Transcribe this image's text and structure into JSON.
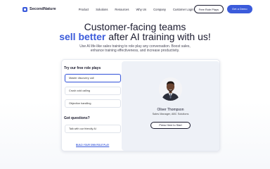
{
  "brand": {
    "name": "SecondNature",
    "accent": "#3b5bdb"
  },
  "nav": {
    "links": [
      "Product",
      "Solutions",
      "Resources",
      "Why Us",
      "Company",
      "Customer Login"
    ],
    "free_plays": "Free Role Plays",
    "demo": "Get a Demo"
  },
  "hero": {
    "line1": "Customer-facing teams",
    "accent": "sell better",
    "line2_rest": " after AI training with us!",
    "subtitle_1": "Use AI life-like sales training to role play any conversation. Boost sales,",
    "subtitle_2": "enhance training effectiveness, and increase productivity."
  },
  "panel": {
    "free_title": "Try our free role plays",
    "options": [
      "Master discovery call",
      "Crush cold calling",
      "Objection handling"
    ],
    "questions_title": "Got questions?",
    "friendly_ai": "Talk with our friendly AI",
    "build_link": "BUILD YOUR OWN ROLE PLAY",
    "persona_name": "Oliver Thompson",
    "persona_role": "Sales Manager, ABC Solutions",
    "start": "Press Here to Start"
  }
}
